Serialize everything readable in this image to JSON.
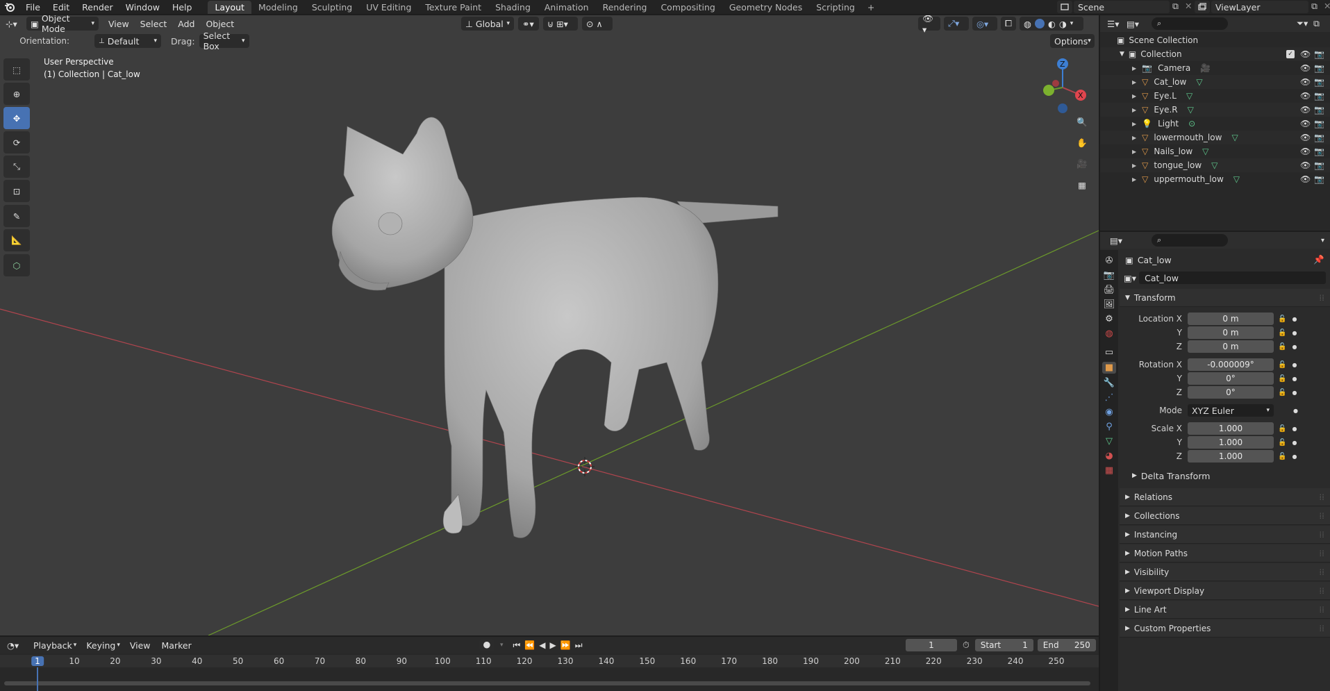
{
  "topbar": {
    "menus": [
      "File",
      "Edit",
      "Render",
      "Window",
      "Help"
    ],
    "workspaces": [
      "Layout",
      "Modeling",
      "Sculpting",
      "UV Editing",
      "Texture Paint",
      "Shading",
      "Animation",
      "Rendering",
      "Compositing",
      "Geometry Nodes",
      "Scripting"
    ],
    "active_workspace": "Layout",
    "plus": "+",
    "scene": "Scene",
    "view_layer": "ViewLayer"
  },
  "viewport": {
    "mode": "Object Mode",
    "menus": [
      "View",
      "Select",
      "Add",
      "Object"
    ],
    "transform_orientation": "Global",
    "orientation_label": "Orientation:",
    "orientation_value": "Default",
    "drag_label": "Drag:",
    "drag_value": "Select Box",
    "options": "Options",
    "perspective": "User Perspective",
    "collection_info": "(1) Collection | Cat_low",
    "gizmo_axes": [
      "Z",
      "X",
      "Y"
    ]
  },
  "outliner": {
    "root": "Scene Collection",
    "collection": "Collection",
    "items": [
      {
        "name": "Camera",
        "type": "camera"
      },
      {
        "name": "Cat_low",
        "type": "mesh"
      },
      {
        "name": "Eye.L",
        "type": "mesh"
      },
      {
        "name": "Eye.R",
        "type": "mesh"
      },
      {
        "name": "Light",
        "type": "light"
      },
      {
        "name": "lowermouth_low",
        "type": "mesh"
      },
      {
        "name": "Nails_low",
        "type": "mesh"
      },
      {
        "name": "tongue_low",
        "type": "mesh"
      },
      {
        "name": "uppermouth_low",
        "type": "mesh"
      }
    ]
  },
  "properties": {
    "object_name": "Cat_low",
    "object_field": "Cat_low",
    "transform_title": "Transform",
    "location_label": "Location X",
    "location": [
      "0 m",
      "0 m",
      "0 m"
    ],
    "rotation_label": "Rotation X",
    "rotation": [
      "-0.000009°",
      "0°",
      "0°"
    ],
    "mode_label": "Mode",
    "mode_value": "XYZ Euler",
    "scale_label": "Scale X",
    "scale": [
      "1.000",
      "1.000",
      "1.000"
    ],
    "axis_y": "Y",
    "axis_z": "Z",
    "delta_transform": "Delta Transform",
    "sections": [
      "Relations",
      "Collections",
      "Instancing",
      "Motion Paths",
      "Visibility",
      "Viewport Display",
      "Line Art",
      "Custom Properties"
    ]
  },
  "timeline": {
    "menus": [
      "Playback",
      "Keying",
      "View",
      "Marker"
    ],
    "current_frame": "1",
    "start_label": "Start",
    "start": "1",
    "end_label": "End",
    "end": "250",
    "ruler_ticks": [
      "1",
      "10",
      "20",
      "30",
      "40",
      "50",
      "60",
      "70",
      "80",
      "90",
      "100",
      "110",
      "120",
      "130",
      "140",
      "150",
      "160",
      "170",
      "180",
      "190",
      "200",
      "210",
      "220",
      "230",
      "240",
      "250"
    ]
  },
  "colors": {
    "accent": "#4772b3",
    "x_axis": "#b0454e",
    "y_axis": "#6c9a2b",
    "z_axis": "#3d7fd4",
    "mesh_icon": "#e09a4a",
    "data_icon": "#5fc98d"
  }
}
